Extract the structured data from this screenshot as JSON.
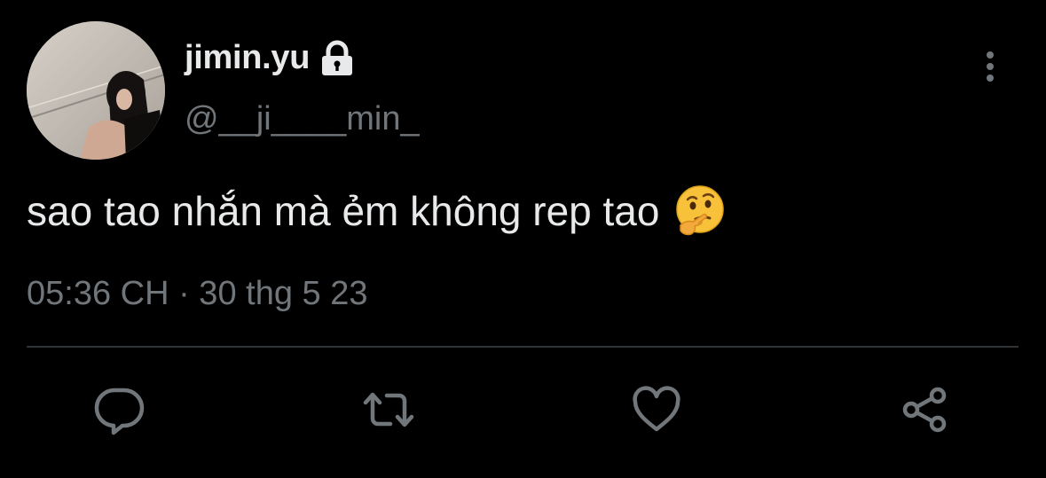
{
  "tweet": {
    "display_name": "jimin.yu",
    "handle": "@__ji____min_",
    "text": "sao tao nhắn mà ẻm không rep tao",
    "timestamp": "05:36 CH · 30 thg 5 23",
    "protected_icon": "lock-icon",
    "emoji": "thinking-face-emoji"
  },
  "actions": {
    "reply_icon": "comment-icon",
    "retweet_icon": "retweet-icon",
    "like_icon": "heart-icon",
    "share_icon": "share-icon",
    "more_icon": "more-vertical-icon"
  },
  "colors": {
    "background": "#000000",
    "primary_text": "#e7e9ea",
    "secondary_text": "#71767b",
    "divider": "#2f3336"
  }
}
